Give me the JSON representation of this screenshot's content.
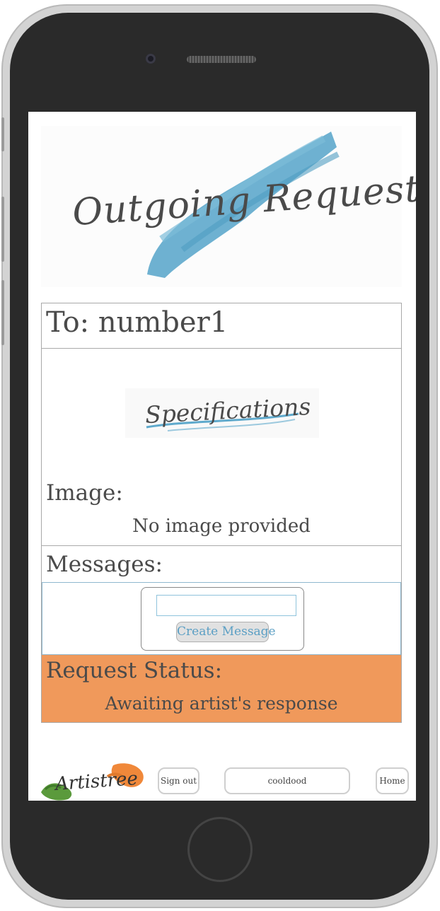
{
  "header": {
    "title": "Outgoing Request"
  },
  "request": {
    "to_text": "To: number1",
    "specifications_title": "Specifications",
    "image_label": "Image:",
    "image_value": "No image provided",
    "messages_label": "Messages:",
    "message_input_value": "",
    "create_message_label": "Create Message",
    "status_label": "Request Status:",
    "status_value": "Awaiting artist's response"
  },
  "footer": {
    "logo_text": "Artistree",
    "sign_out_label": "Sign out",
    "username": "cooldood",
    "home_label": "Home"
  },
  "colors": {
    "status_bg": "#f0995b",
    "accent_blue": "#5ea9cc",
    "text": "#4a4a4a"
  }
}
